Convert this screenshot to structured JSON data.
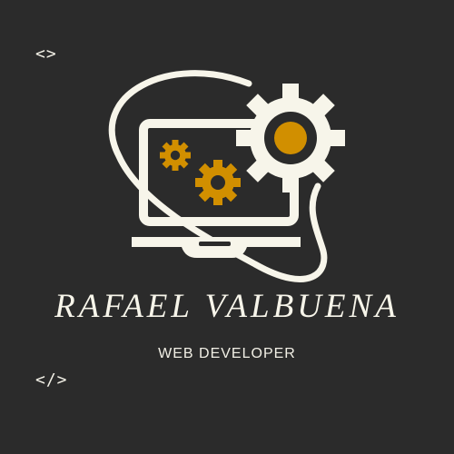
{
  "brand": {
    "name": "RAFAEL VALBUENA",
    "role": "WEB DEVELOPER"
  },
  "code_tags": {
    "open": "<>",
    "close": "</>"
  },
  "icons": {
    "logo": "laptop-gears-orbit-icon",
    "large_gear": "large-gear-icon",
    "small_gears": "small-gears-icon"
  },
  "colors": {
    "background": "#2b2b2b",
    "ivory": "#f7f5ea",
    "accent": "#d18f00"
  }
}
